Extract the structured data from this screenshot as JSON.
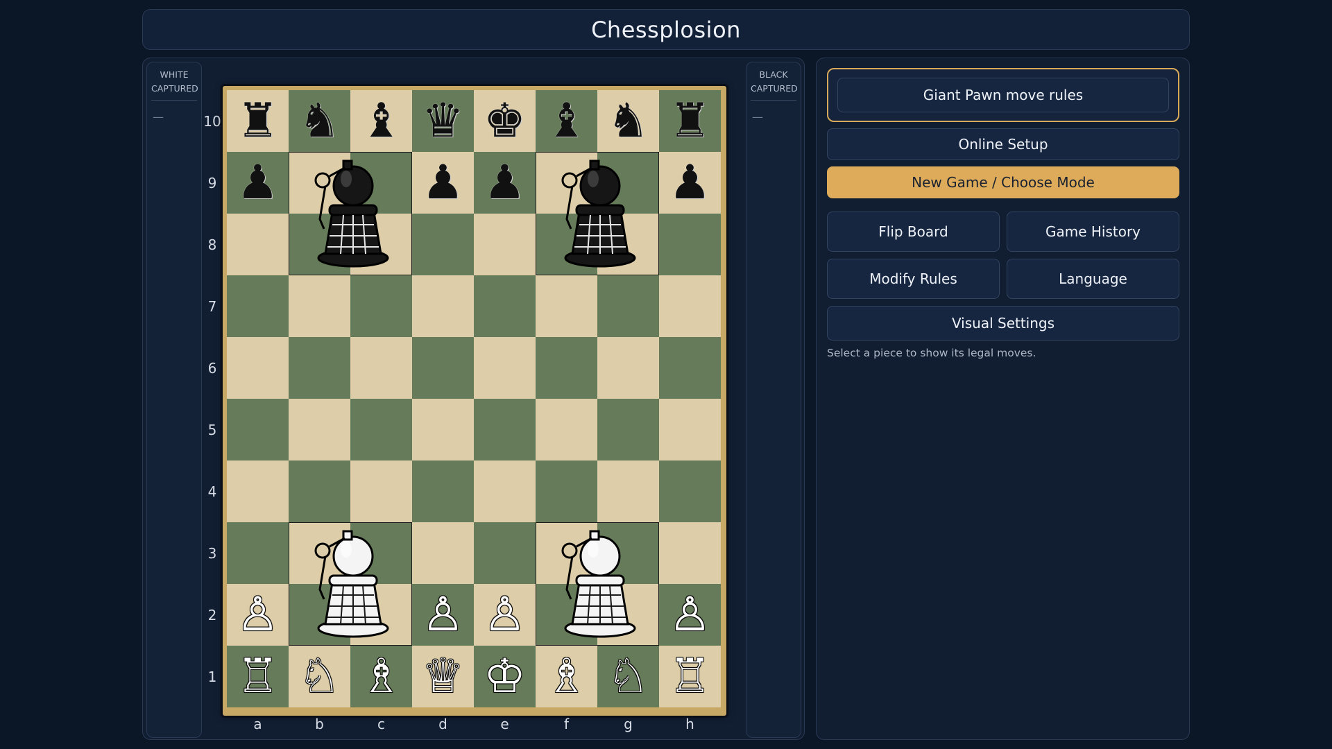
{
  "app": {
    "title": "Chessplosion"
  },
  "captured": {
    "white": {
      "title_line1": "WHITE",
      "title_line2": "CAPTURED",
      "empty": "—"
    },
    "black": {
      "title_line1": "BLACK",
      "title_line2": "CAPTURED",
      "empty": "—"
    }
  },
  "board": {
    "files": [
      "a",
      "b",
      "c",
      "d",
      "e",
      "f",
      "g",
      "h"
    ],
    "ranks": [
      "10",
      "9",
      "8",
      "7",
      "6",
      "5",
      "4",
      "3",
      "2",
      "1"
    ],
    "light_color": "#ddcda8",
    "dark_color": "#667b5a",
    "pieces": [
      {
        "sq": "a10",
        "c": "b",
        "p": "rook"
      },
      {
        "sq": "b10",
        "c": "b",
        "p": "knight"
      },
      {
        "sq": "c10",
        "c": "b",
        "p": "bishop"
      },
      {
        "sq": "d10",
        "c": "b",
        "p": "queen"
      },
      {
        "sq": "e10",
        "c": "b",
        "p": "king"
      },
      {
        "sq": "f10",
        "c": "b",
        "p": "bishop"
      },
      {
        "sq": "g10",
        "c": "b",
        "p": "knight"
      },
      {
        "sq": "h10",
        "c": "b",
        "p": "rook"
      },
      {
        "sq": "a9",
        "c": "b",
        "p": "pawn"
      },
      {
        "sq": "d9",
        "c": "b",
        "p": "pawn"
      },
      {
        "sq": "e9",
        "c": "b",
        "p": "pawn"
      },
      {
        "sq": "h9",
        "c": "b",
        "p": "pawn"
      },
      {
        "sq": "a2",
        "c": "w",
        "p": "pawn"
      },
      {
        "sq": "d2",
        "c": "w",
        "p": "pawn"
      },
      {
        "sq": "e2",
        "c": "w",
        "p": "pawn"
      },
      {
        "sq": "h2",
        "c": "w",
        "p": "pawn"
      },
      {
        "sq": "a1",
        "c": "w",
        "p": "rook"
      },
      {
        "sq": "b1",
        "c": "w",
        "p": "knight"
      },
      {
        "sq": "c1",
        "c": "w",
        "p": "bishop"
      },
      {
        "sq": "d1",
        "c": "w",
        "p": "queen"
      },
      {
        "sq": "e1",
        "c": "w",
        "p": "king"
      },
      {
        "sq": "f1",
        "c": "w",
        "p": "bishop"
      },
      {
        "sq": "g1",
        "c": "w",
        "p": "knight"
      },
      {
        "sq": "h1",
        "c": "w",
        "p": "rook"
      }
    ],
    "giant_pawns": [
      {
        "sq": "b9",
        "c": "b",
        "icon": "giant-grenade-pawn-icon"
      },
      {
        "sq": "f9",
        "c": "b",
        "icon": "giant-grenade-pawn-icon"
      },
      {
        "sq": "b3",
        "c": "w",
        "icon": "giant-grenade-pawn-icon"
      },
      {
        "sq": "f3",
        "c": "w",
        "icon": "giant-grenade-pawn-icon"
      }
    ]
  },
  "controls": {
    "giant_pawn_rules": "Giant Pawn move rules",
    "online_setup": "Online Setup",
    "new_game": "New Game / Choose Mode",
    "flip_board": "Flip Board",
    "game_history": "Game History",
    "modify_rules": "Modify Rules",
    "language": "Language",
    "visual_settings": "Visual Settings",
    "hint": "Select a piece to show its legal moves.",
    "accent_color": "#ddab5a"
  }
}
